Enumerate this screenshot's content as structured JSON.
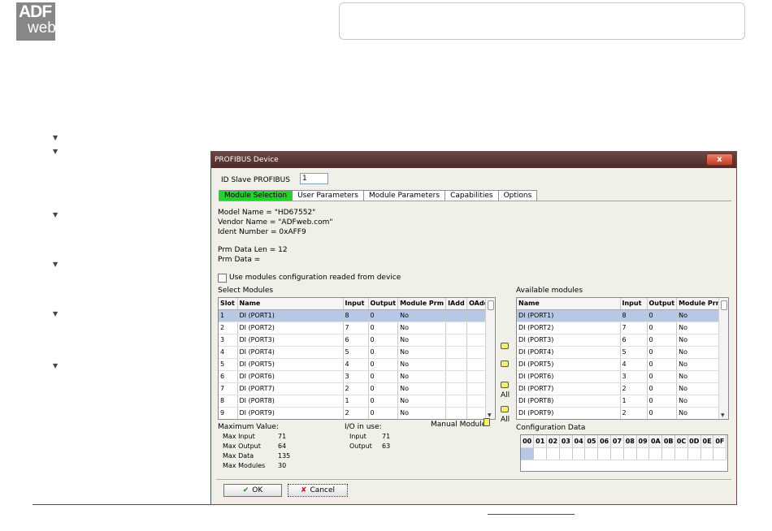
{
  "logo": {
    "line1": "ADF",
    "line2": "web"
  },
  "dialog": {
    "title": "PROFIBUS Device",
    "close_label": "x",
    "id_slave_label": "ID Slave PROFIBUS",
    "id_slave_value": "1",
    "tabs": [
      "Module Selection",
      "User Parameters",
      "Module Parameters",
      "Capabilities",
      "Options"
    ],
    "info": {
      "model_name": "Model Name = \"HD67552\"",
      "vendor_name": "Vendor Name = \"ADFweb.com\"",
      "ident_number": "Ident Number = 0xAFF9",
      "prm_data_len": "Prm Data Len = 12",
      "prm_data": "Prm Data ="
    },
    "use_modules_label": "Use modules configuration readed from device",
    "select_modules": {
      "label": "Select Modules",
      "columns": [
        "Slot",
        "Name",
        "Input",
        "Output",
        "Module Prm",
        "IAdd",
        "OAdd"
      ],
      "rows": [
        [
          "1",
          "DI  (PORT1)",
          "8",
          "0",
          "No",
          "",
          ""
        ],
        [
          "2",
          "DI  (PORT2)",
          "7",
          "0",
          "No",
          "",
          ""
        ],
        [
          "3",
          "DI  (PORT3)",
          "6",
          "0",
          "No",
          "",
          ""
        ],
        [
          "4",
          "DI  (PORT4)",
          "5",
          "0",
          "No",
          "",
          ""
        ],
        [
          "5",
          "DI  (PORT5)",
          "4",
          "0",
          "No",
          "",
          ""
        ],
        [
          "6",
          "DI  (PORT6)",
          "3",
          "0",
          "No",
          "",
          ""
        ],
        [
          "7",
          "DI  (PORT7)",
          "2",
          "0",
          "No",
          "",
          ""
        ],
        [
          "8",
          "DI  (PORT8)",
          "1",
          "0",
          "No",
          "",
          ""
        ],
        [
          "9",
          "DI  (PORT9)",
          "2",
          "0",
          "No",
          "",
          ""
        ]
      ]
    },
    "available_modules": {
      "label": "Available modules",
      "columns": [
        "Name",
        "Input",
        "Output",
        "Module Prm"
      ],
      "rows": [
        [
          "DI  (PORT1)",
          "8",
          "0",
          "No"
        ],
        [
          "DI  (PORT2)",
          "7",
          "0",
          "No"
        ],
        [
          "DI  (PORT3)",
          "6",
          "0",
          "No"
        ],
        [
          "DI  (PORT4)",
          "5",
          "0",
          "No"
        ],
        [
          "DI  (PORT5)",
          "4",
          "0",
          "No"
        ],
        [
          "DI  (PORT6)",
          "3",
          "0",
          "No"
        ],
        [
          "DI  (PORT7)",
          "2",
          "0",
          "No"
        ],
        [
          "DI  (PORT8)",
          "1",
          "0",
          "No"
        ],
        [
          "DI  (PORT9)",
          "2",
          "0",
          "No"
        ]
      ]
    },
    "transfer": {
      "all_label_1": "All",
      "all_label_2": "All"
    },
    "max_value": {
      "label": "Maximum Value:",
      "rows": [
        [
          "Max Input",
          "71"
        ],
        [
          "Max Output",
          "64"
        ],
        [
          "Max Data",
          "135"
        ],
        [
          "Max Modules",
          "30"
        ]
      ]
    },
    "io_in_use": {
      "label": "I/O in use:",
      "rows": [
        [
          "Input",
          "71"
        ],
        [
          "Output",
          "63"
        ]
      ]
    },
    "manual_module_label": "Manual Module",
    "config_data": {
      "label": "Configuration Data",
      "headers": [
        "00",
        "01",
        "02",
        "03",
        "04",
        "05",
        "06",
        "07",
        "08",
        "09",
        "0A",
        "0B",
        "0C",
        "0D",
        "0E",
        "0F"
      ]
    },
    "ok_label": "OK",
    "cancel_label": "Cancel"
  }
}
